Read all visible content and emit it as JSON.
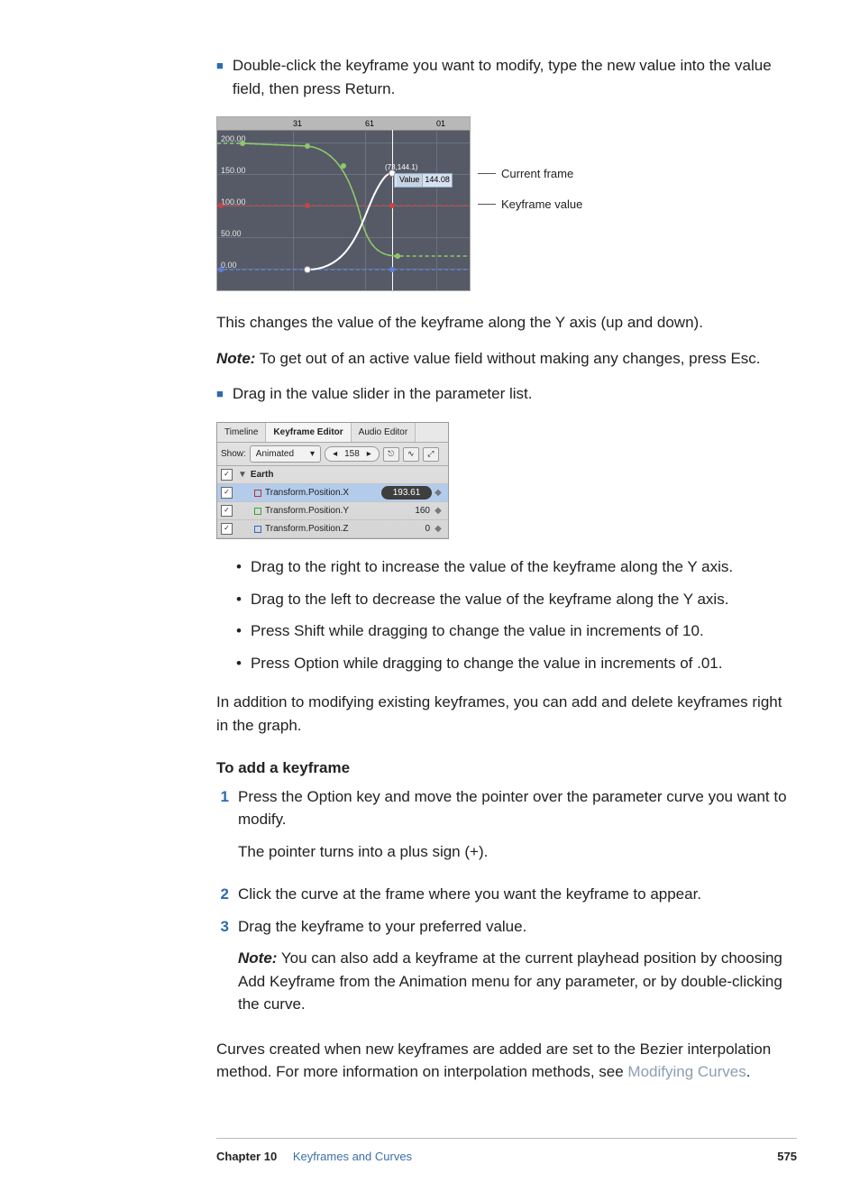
{
  "bullets": {
    "b1": "Double-click the keyframe you want to modify, type the new value into the value field, then press Return.",
    "b2": "Drag in the value slider in the parameter list."
  },
  "fig1": {
    "ruler": {
      "t1": "31",
      "t2": "61",
      "t3": "01"
    },
    "ylabels": {
      "y1": "200.00",
      "y2": "150.00",
      "y3": "100.00",
      "y4": "50.00",
      "y5": "0.00"
    },
    "coord": "(73,144.1)",
    "valbox_label": "Value",
    "valbox_value": "144.08",
    "callout_current": "Current frame",
    "callout_kfvalue": "Keyframe value"
  },
  "after_fig1": "This changes the value of the keyframe along the Y axis (up and down).",
  "note1_label": "Note:",
  "note1_text": "  To get out of an active value field without making any changes, press Esc.",
  "fig2": {
    "tab_timeline": "Timeline",
    "tab_kf": "Keyframe Editor",
    "tab_audio": "Audio Editor",
    "show_label": "Show:",
    "show_value": "Animated",
    "frame_value": "158",
    "group_name": "Earth",
    "row_x_name": "Transform.Position.X",
    "row_x_val": "193.61",
    "row_y_name": "Transform.Position.Y",
    "row_y_val": "160",
    "row_z_name": "Transform.Position.Z",
    "row_z_val": "0"
  },
  "sublist": {
    "s1": "Drag to the right to increase the value of the keyframe along the Y axis.",
    "s2": "Drag to the left to decrease the value of the keyframe along the Y axis.",
    "s3": "Press Shift while dragging to change the value in increments of 10.",
    "s4": "Press Option while dragging to change the value in increments of .01."
  },
  "para_add_delete": "In addition to modifying existing keyframes, you can add and delete keyframes right in the graph.",
  "heading_add": "To add a keyframe",
  "steps": {
    "n1": "1",
    "s1": "Press the Option key and move the pointer over the parameter curve you want to modify.",
    "s1b": "The pointer turns into a plus sign (+).",
    "n2": "2",
    "s2": "Click the curve at the frame where you want the keyframe to appear.",
    "n3": "3",
    "s3": "Drag the keyframe to your preferred value.",
    "note_label": "Note:",
    "note_text": "  You can also add a keyframe at the current playhead position by choosing Add Keyframe from the Animation menu for any parameter, or by double-clicking the curve."
  },
  "para_curves_a": "Curves created when new keyframes are added are set to the Bezier interpolation method. For more information on interpolation methods, see ",
  "para_curves_link": "Modifying Curves",
  "para_curves_b": ".",
  "footer": {
    "chapter_label": "Chapter 10",
    "chapter_title": "Keyframes and Curves",
    "page_number": "575"
  }
}
